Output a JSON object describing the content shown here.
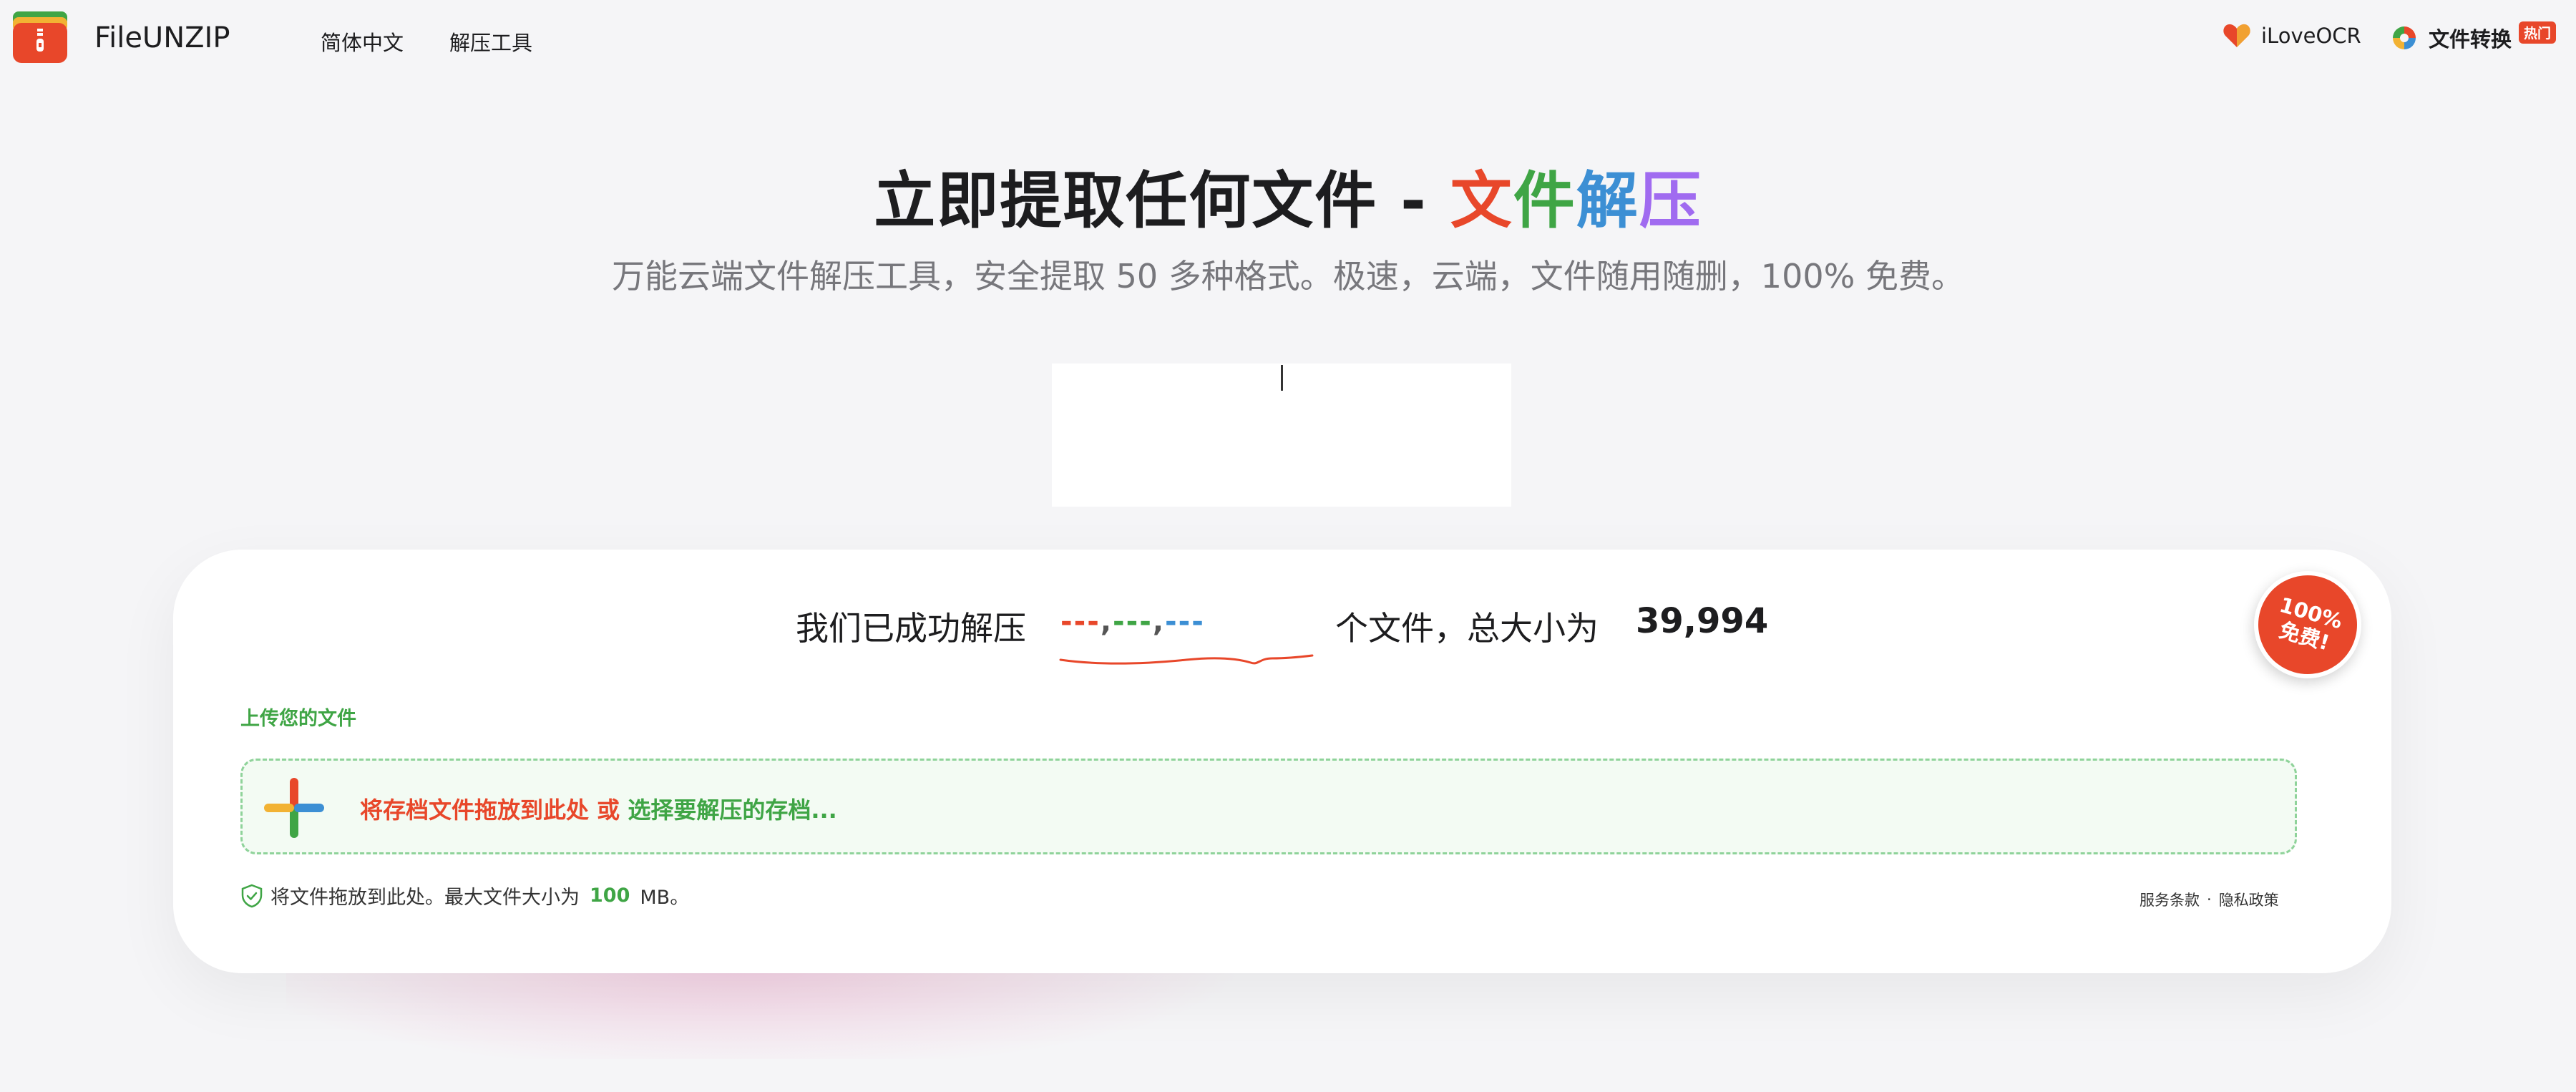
{
  "header": {
    "brand": "FileUNZIP",
    "nav": {
      "language": "简体中文",
      "tools": "解压工具"
    },
    "ocr_link": "iLoveOCR",
    "convert_link": "文件转换",
    "hot_badge": "热门"
  },
  "hero": {
    "title_prefix": "立即提取任何文件 - ",
    "title_colored": [
      "文",
      "件",
      "解",
      "压"
    ],
    "subtitle": "万能云端文件解压工具，安全提取 50 多种格式。极速，云端，文件随用随删，100% 免费。"
  },
  "stats": {
    "prefix": "我们已成功解压",
    "counter_parts": [
      "---",
      ",",
      "---",
      ",",
      "---"
    ],
    "middle": "个文件，总大小为",
    "size": "39,994"
  },
  "badge": {
    "line1": "100%",
    "line2": "免费!"
  },
  "upload": {
    "label": "上传您的文件",
    "drop_text": "将存档文件拖放到此处",
    "or": "或",
    "select_text": "选择要解压的存档..."
  },
  "hint": {
    "prefix": "将文件拖放到此处。最大文件大小为",
    "max_size": "100",
    "unit": "MB。"
  },
  "legal": {
    "terms": "服务条款",
    "separator": "·",
    "privacy": "隐私政策"
  },
  "colors": {
    "red": "#e8472a",
    "green": "#3fa545",
    "blue": "#3c8fd4",
    "purple": "#a06bf0",
    "page_bg": "#f5f5f7"
  },
  "icons": {
    "logo": "zip-archive-icon",
    "ocr": "heart-icon",
    "convert": "swirl-icon",
    "plus": "plus-icon",
    "shield": "shield-check-icon"
  }
}
